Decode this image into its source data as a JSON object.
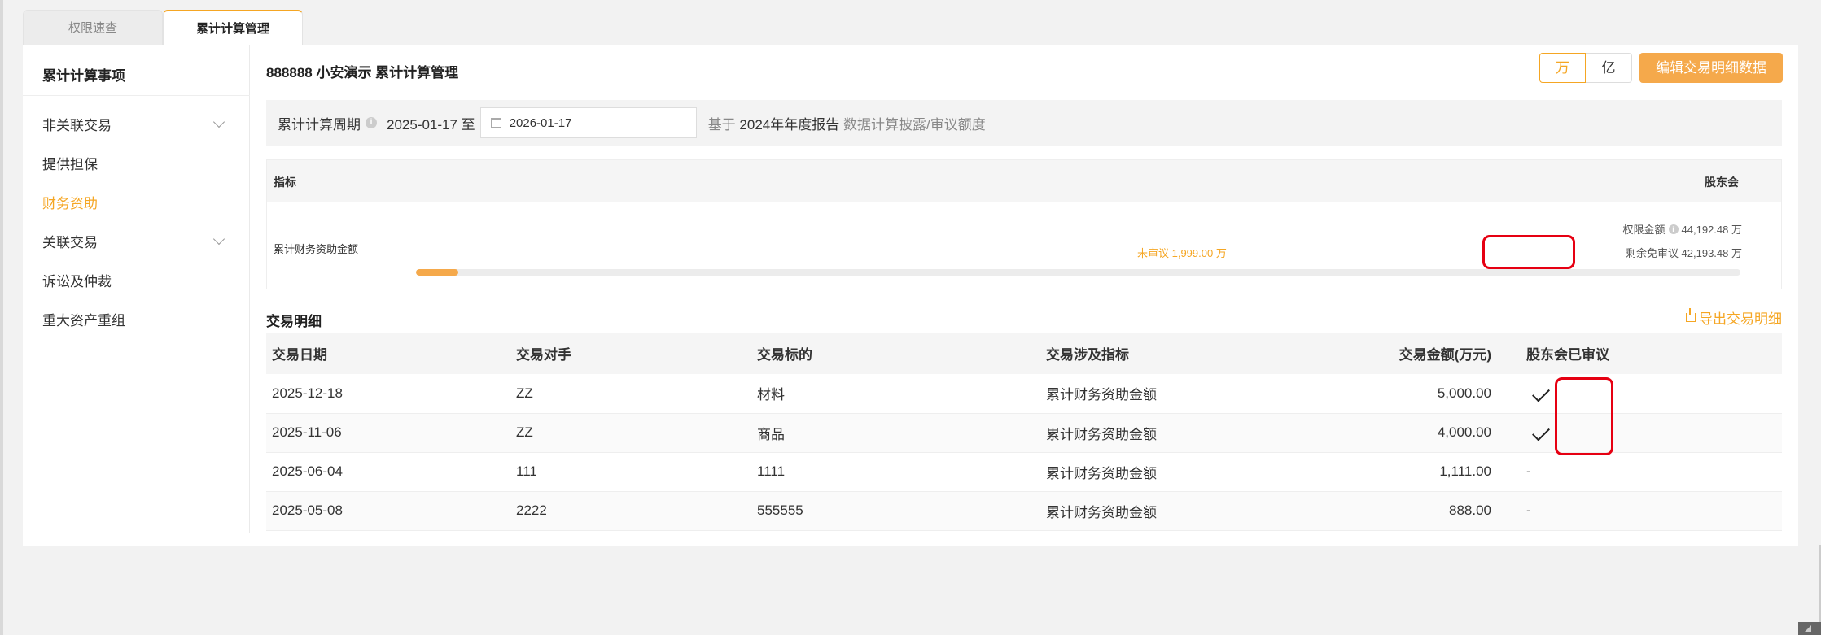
{
  "tabs": [
    {
      "label": "权限速查"
    },
    {
      "label": "累计计算管理"
    }
  ],
  "sidebar": {
    "title": "累计计算事项",
    "items": [
      {
        "label": "非关联交易"
      },
      {
        "label": "提供担保"
      },
      {
        "label": "财务资助"
      },
      {
        "label": "关联交易"
      },
      {
        "label": "诉讼及仲裁"
      },
      {
        "label": "重大资产重组"
      }
    ]
  },
  "header": {
    "title": "888888 小安演示 累计计算管理",
    "unit_wan": "万",
    "unit_yi": "亿",
    "edit_button": "编辑交易明细数据"
  },
  "period": {
    "label": "累计计算周期",
    "start": "2025-01-17 至",
    "end_value": "2026-01-17",
    "basis_prefix": "基于",
    "basis_report": "2024年年度报告",
    "basis_suffix": "数据计算披露/审议额度"
  },
  "indicator": {
    "col_indicator": "指标",
    "col_body": "股东会",
    "row_label": "累计财务资助金额",
    "limit_label": "权限金额",
    "limit_value": "44,192.48 万",
    "unreviewed_text": "未审议 1,999.00 万",
    "remaining_text": "剩余免审议 42,193.48 万",
    "progress_fraction": 0.032
  },
  "details": {
    "title": "交易明细",
    "export_label": "导出交易明细",
    "columns": [
      "交易日期",
      "交易对手",
      "交易标的",
      "交易涉及指标",
      "交易金额(万元)",
      "股东会已审议"
    ],
    "rows": [
      {
        "date": "2025-12-18",
        "party": "ZZ",
        "subject": "材料",
        "indicator": "累计财务资助金额",
        "amount": "5,000.00",
        "reviewed": true
      },
      {
        "date": "2025-11-06",
        "party": "ZZ",
        "subject": "商品",
        "indicator": "累计财务资助金额",
        "amount": "4,000.00",
        "reviewed": true
      },
      {
        "date": "2025-06-04",
        "party": "111",
        "subject": "1111",
        "indicator": "累计财务资助金额",
        "amount": "1,111.00",
        "reviewed_text": "-"
      },
      {
        "date": "2025-05-08",
        "party": "2222",
        "subject": "555555",
        "indicator": "累计财务资助金额",
        "amount": "888.00",
        "reviewed_text": "-"
      }
    ]
  },
  "colors": {
    "accent": "#f5a623",
    "button": "#f5a94b",
    "highlight": "#e60012"
  }
}
